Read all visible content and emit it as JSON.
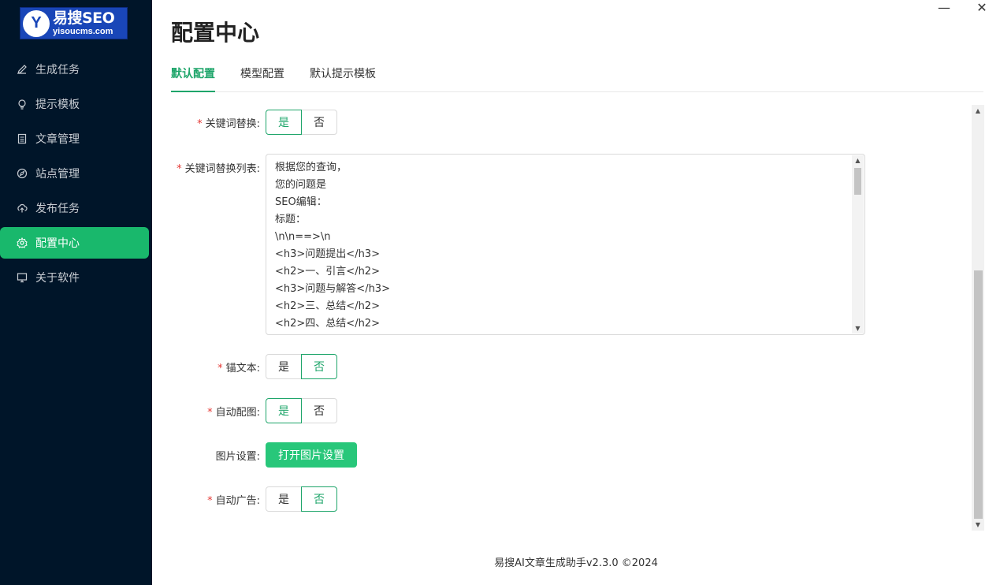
{
  "logo": {
    "mark": "Y",
    "title": "易搜SEO",
    "subtitle": "yisoucms.com"
  },
  "sidebar": {
    "items": [
      {
        "label": "生成任务",
        "icon": "edit-icon"
      },
      {
        "label": "提示模板",
        "icon": "bulb-icon"
      },
      {
        "label": "文章管理",
        "icon": "document-icon"
      },
      {
        "label": "站点管理",
        "icon": "compass-icon"
      },
      {
        "label": "发布任务",
        "icon": "cloud-upload-icon"
      },
      {
        "label": "配置中心",
        "icon": "gear-icon",
        "active": true
      },
      {
        "label": "关于软件",
        "icon": "monitor-icon"
      }
    ]
  },
  "window": {
    "minimize": "—",
    "close": "✕"
  },
  "page": {
    "title": "配置中心"
  },
  "tabs": [
    {
      "label": "默认配置",
      "active": true
    },
    {
      "label": "模型配置"
    },
    {
      "label": "默认提示模板"
    }
  ],
  "form": {
    "keyword_replace": {
      "label": "关键词替换:",
      "yes": "是",
      "no": "否",
      "selected": "是"
    },
    "keyword_list": {
      "label": "关键词替换列表:",
      "lines": [
        "根据您的查询，",
        "您的问题是",
        "SEO编辑：",
        "标题：",
        "\\n\\n==>\\n",
        "<h3>问题提出</h3>",
        "<h2>一、引言</h2>",
        "<h3>问题与解答</h3>",
        "<h2>三、总结</h2>",
        "<h2>四、总结</h2>"
      ]
    },
    "anchor_text": {
      "label": "锚文本:",
      "yes": "是",
      "no": "否",
      "selected": "否"
    },
    "auto_image": {
      "label": "自动配图:",
      "yes": "是",
      "no": "否",
      "selected": "是"
    },
    "image_settings": {
      "label": "图片设置:",
      "button": "打开图片设置"
    },
    "auto_ads": {
      "label": "自动广告:",
      "yes": "是",
      "no": "否",
      "selected": "否"
    }
  },
  "colors": {
    "sidebar_bg": "#001529",
    "accent": "#1ea56a",
    "button": "#28c77a"
  },
  "footer": {
    "text": "易搜AI文章生成助手v2.3.0 ©2024"
  }
}
